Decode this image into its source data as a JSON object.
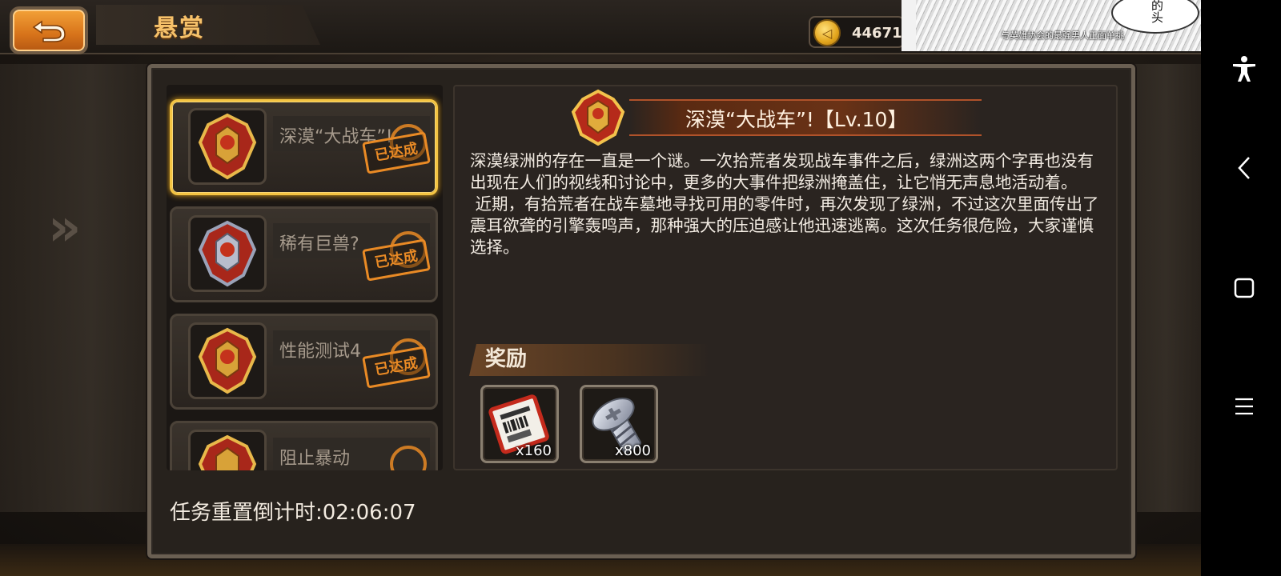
{
  "header": {
    "title": "悬赏",
    "coin_value": "44671"
  },
  "ad": {
    "bubble_text": "的\n头",
    "caption": "与英雄协会的最强男人正面单挑"
  },
  "task_list": {
    "items": [
      {
        "name": "深漠“大战车”!",
        "status": "已达成",
        "selected": true
      },
      {
        "name": "稀有巨兽?",
        "status": "已达成",
        "selected": false
      },
      {
        "name": "性能测试4",
        "status": "已达成",
        "selected": false
      },
      {
        "name": "阻止暴动",
        "status": "",
        "selected": false
      }
    ]
  },
  "detail": {
    "title": "深漠“大战车”!【Lv.10】",
    "description_p1": "深漠绿洲的存在一直是一个谜。一次拾荒者发现战车事件之后，绿洲这两个字再也没有出现在人们的视线和讨论中，更多的大事件把绿洲掩盖住，让它悄无声息地活动着。",
    "description_p2": " 近期，有拾荒者在战车墓地寻找可用的零件时，再次发现了绿洲，不过这次里面传出了震耳欲聋的引擎轰鸣声，那种强大的压迫感让他迅速逃离。这次任务很危险，大家谨慎选择。",
    "reward_label": "奖励",
    "rewards": [
      {
        "icon": "ticket-icon",
        "count": "x160"
      },
      {
        "icon": "screw-icon",
        "count": "x800"
      }
    ]
  },
  "footer": {
    "countdown": "任务重置倒计时:02:06:07"
  },
  "colors": {
    "accent_orange": "#e98a25",
    "title_gold": "#f6c16a",
    "selected_border": "#f4c442"
  }
}
